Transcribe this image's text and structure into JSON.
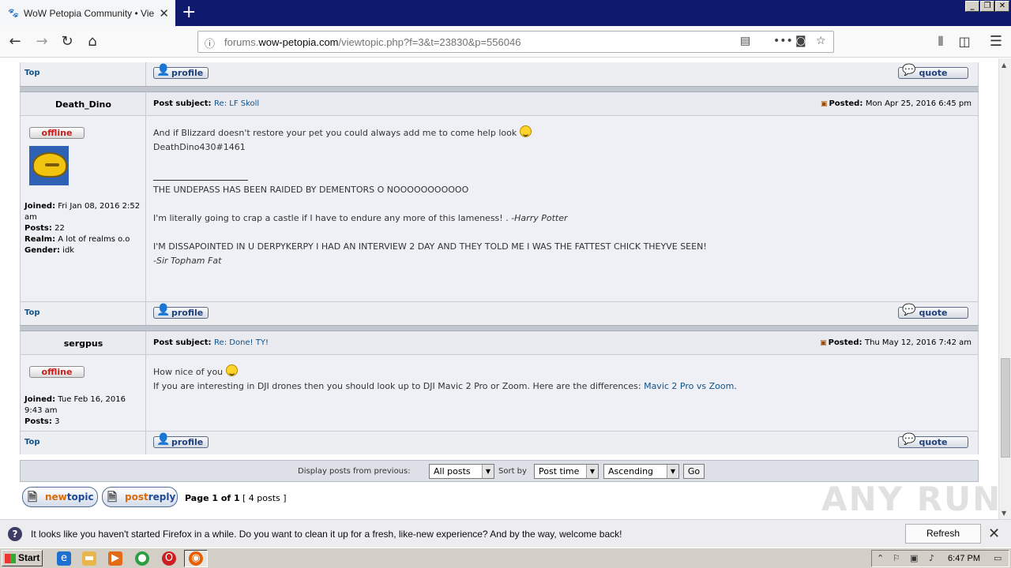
{
  "browser": {
    "tab_title": "WoW Petopia Community • View to",
    "url_prefix": "forums.",
    "url_domain": "wow-petopia.com",
    "url_path": "/viewtopic.php?f=3&t=23830&p=556046"
  },
  "links": {
    "top": "Top"
  },
  "buttons": {
    "profile": "profile",
    "quote": "quote"
  },
  "labels": {
    "post_subject": "Post subject:",
    "posted": "Posted:",
    "offline": "offline",
    "joined": "Joined:",
    "posts": "Posts:",
    "realm": "Realm:",
    "gender": "Gender:"
  },
  "posts": [
    {
      "author": "Death_Dino",
      "subject": "Re: LF Skoll",
      "posted": "Mon Apr 25, 2016 6:45 pm",
      "joined": "Fri Jan 08, 2016 2:52 am",
      "post_count": "22",
      "realm": "A lot of realms o.o",
      "gender": "idk",
      "line1": "And if Blizzard doesn't restore your pet you could always add me to come help look",
      "line2": "DeathDino430#1461",
      "sig1": "THE UNDEPASS HAS BEEN RAIDED BY DEMENTORS O NOOOOOOOOOOO",
      "sig2": "I'm literally going to crap a castle if I have to endure any more of this lameness! .",
      "sig2_attr": "-Harry Potter",
      "sig3": "I'M DISSAPOINTED IN U DERPYKERPY I HAD AN INTERVIEW 2 DAY AND THEY TOLD ME I WAS THE FATTEST CHICK THEYVE SEEN!",
      "sig3_attr": "-Sir Topham Fat"
    },
    {
      "author": "sergpus",
      "subject": "Re: Done! TY!",
      "posted": "Thu May 12, 2016 7:42 am",
      "joined": "Tue Feb 16, 2016 9:43 am",
      "post_count": "3",
      "line1": "How nice of you",
      "line2": "If you are interesting in DJI drones then you should look up to DJI Mavic 2 Pro or Zoom. Here are the differences:",
      "link": "Mavic 2 Pro vs Zoom",
      "link_suffix": "."
    }
  ],
  "footer": {
    "display_label": "Display posts from previous:",
    "display_value": "All posts",
    "sort_label": "Sort by",
    "sort_value": "Post time",
    "order_value": "Ascending",
    "go": "Go"
  },
  "pagination": {
    "newtopic_a": "new",
    "newtopic_b": "topic",
    "postreply_a": "post",
    "postreply_b": "reply",
    "page": "Page 1 of 1",
    "count": "[ 4 posts ]"
  },
  "watermark": "ANY RUN",
  "notification": {
    "message": "It looks like you haven't started Firefox in a while. Do you want to clean it up for a fresh, like-new experience? And by the way, welcome back!",
    "button": "Refresh Firefox…"
  },
  "taskbar": {
    "start": "Start",
    "time": "6:47 PM"
  }
}
